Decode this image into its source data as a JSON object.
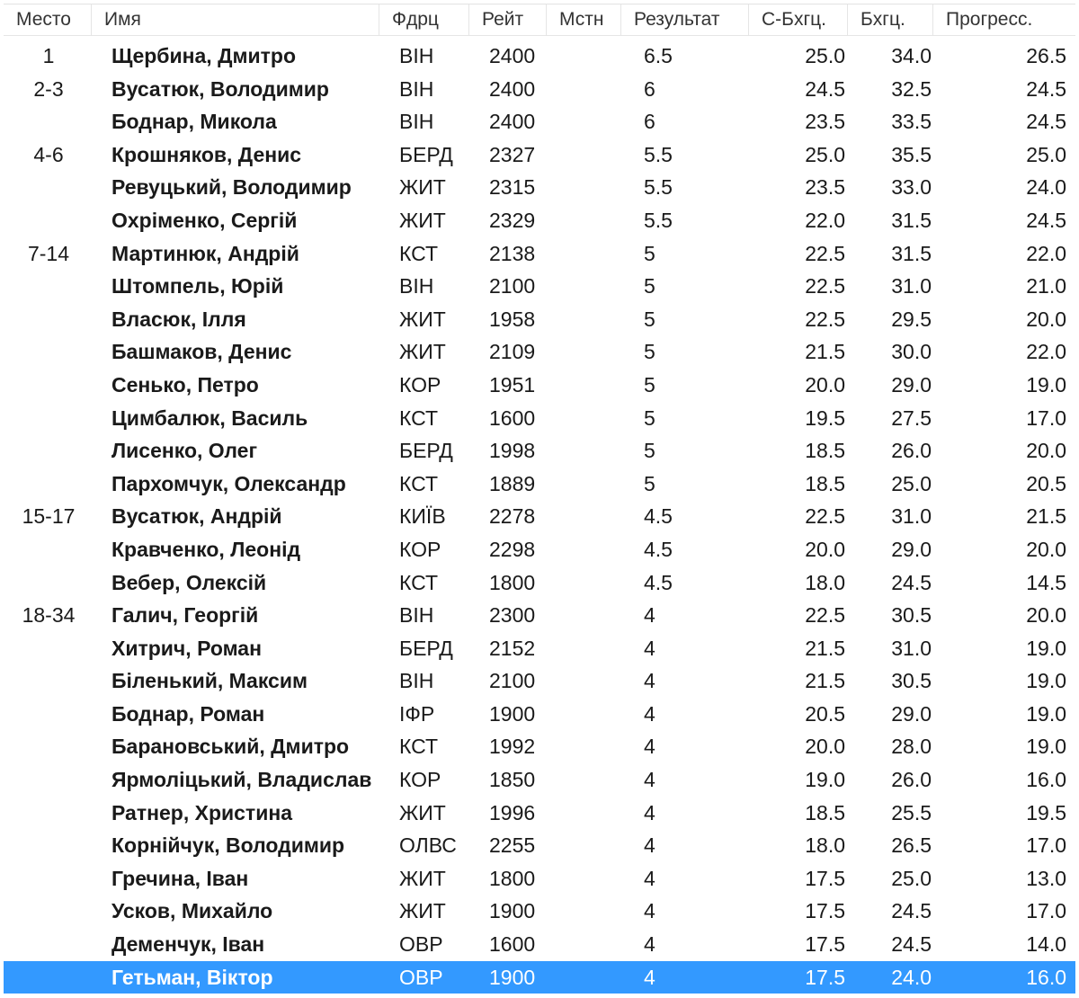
{
  "columns": {
    "place": "Место",
    "name": "Имя",
    "fed": "Фдрц",
    "rating": "Рейт",
    "local": "Мстн",
    "result": "Результат",
    "sbh": "С-Бхгц.",
    "bh": "Бхгц.",
    "prog": "Прогресс."
  },
  "selected_row_index": 28,
  "rows": [
    {
      "place": "1",
      "name": "Щербина, Дмитро",
      "fed": "ВІН",
      "rating": "2400",
      "local": "",
      "result": "6.5",
      "sbh": "25.0",
      "bh": "34.0",
      "prog": "26.5"
    },
    {
      "place": "2-3",
      "name": "Вусатюк, Володимир",
      "fed": "ВІН",
      "rating": "2400",
      "local": "",
      "result": "6",
      "sbh": "24.5",
      "bh": "32.5",
      "prog": "24.5"
    },
    {
      "place": "",
      "name": "Боднар, Микола",
      "fed": "ВІН",
      "rating": "2400",
      "local": "",
      "result": "6",
      "sbh": "23.5",
      "bh": "33.5",
      "prog": "24.5"
    },
    {
      "place": "4-6",
      "name": "Крошняков, Денис",
      "fed": "БЕРД",
      "rating": "2327",
      "local": "",
      "result": "5.5",
      "sbh": "25.0",
      "bh": "35.5",
      "prog": "25.0"
    },
    {
      "place": "",
      "name": "Ревуцький, Володимир",
      "fed": "ЖИТ",
      "rating": "2315",
      "local": "",
      "result": "5.5",
      "sbh": "23.5",
      "bh": "33.0",
      "prog": "24.0"
    },
    {
      "place": "",
      "name": "Охріменко, Сергій",
      "fed": "ЖИТ",
      "rating": "2329",
      "local": "",
      "result": "5.5",
      "sbh": "22.0",
      "bh": "31.5",
      "prog": "24.5"
    },
    {
      "place": "7-14",
      "name": "Мартинюк, Андрій",
      "fed": "КСТ",
      "rating": "2138",
      "local": "",
      "result": "5",
      "sbh": "22.5",
      "bh": "31.5",
      "prog": "22.0"
    },
    {
      "place": "",
      "name": "Штомпель, Юрій",
      "fed": "ВІН",
      "rating": "2100",
      "local": "",
      "result": "5",
      "sbh": "22.5",
      "bh": "31.0",
      "prog": "21.0"
    },
    {
      "place": "",
      "name": "Власюк, Ілля",
      "fed": "ЖИТ",
      "rating": "1958",
      "local": "",
      "result": "5",
      "sbh": "22.5",
      "bh": "29.5",
      "prog": "20.0"
    },
    {
      "place": "",
      "name": "Башмаков, Денис",
      "fed": "ЖИТ",
      "rating": "2109",
      "local": "",
      "result": "5",
      "sbh": "21.5",
      "bh": "30.0",
      "prog": "22.0"
    },
    {
      "place": "",
      "name": "Сенько, Петро",
      "fed": "КОР",
      "rating": "1951",
      "local": "",
      "result": "5",
      "sbh": "20.0",
      "bh": "29.0",
      "prog": "19.0"
    },
    {
      "place": "",
      "name": "Цимбалюк, Василь",
      "fed": "КСТ",
      "rating": "1600",
      "local": "",
      "result": "5",
      "sbh": "19.5",
      "bh": "27.5",
      "prog": "17.0"
    },
    {
      "place": "",
      "name": "Лисенко, Олег",
      "fed": "БЕРД",
      "rating": "1998",
      "local": "",
      "result": "5",
      "sbh": "18.5",
      "bh": "26.0",
      "prog": "20.0"
    },
    {
      "place": "",
      "name": "Пархомчук, Олександр",
      "fed": "КСТ",
      "rating": "1889",
      "local": "",
      "result": "5",
      "sbh": "18.5",
      "bh": "25.0",
      "prog": "20.5"
    },
    {
      "place": "15-17",
      "name": "Вусатюк, Андрій",
      "fed": "КИЇВ",
      "rating": "2278",
      "local": "",
      "result": "4.5",
      "sbh": "22.5",
      "bh": "31.0",
      "prog": "21.5"
    },
    {
      "place": "",
      "name": "Кравченко, Леонід",
      "fed": "КОР",
      "rating": "2298",
      "local": "",
      "result": "4.5",
      "sbh": "20.0",
      "bh": "29.0",
      "prog": "20.0"
    },
    {
      "place": "",
      "name": "Вебер, Олексій",
      "fed": "КСТ",
      "rating": "1800",
      "local": "",
      "result": "4.5",
      "sbh": "18.0",
      "bh": "24.5",
      "prog": "14.5"
    },
    {
      "place": "18-34",
      "name": "Галич, Георгій",
      "fed": "ВІН",
      "rating": "2300",
      "local": "",
      "result": "4",
      "sbh": "22.5",
      "bh": "30.5",
      "prog": "20.0"
    },
    {
      "place": "",
      "name": "Хитрич, Роман",
      "fed": "БЕРД",
      "rating": "2152",
      "local": "",
      "result": "4",
      "sbh": "21.5",
      "bh": "31.0",
      "prog": "19.0"
    },
    {
      "place": "",
      "name": "Біленький, Максим",
      "fed": "ВІН",
      "rating": "2100",
      "local": "",
      "result": "4",
      "sbh": "21.5",
      "bh": "30.5",
      "prog": "19.0"
    },
    {
      "place": "",
      "name": "Боднар, Роман",
      "fed": "ІФР",
      "rating": "1900",
      "local": "",
      "result": "4",
      "sbh": "20.5",
      "bh": "29.0",
      "prog": "19.0"
    },
    {
      "place": "",
      "name": "Барановський, Дмитро",
      "fed": "КСТ",
      "rating": "1992",
      "local": "",
      "result": "4",
      "sbh": "20.0",
      "bh": "28.0",
      "prog": "19.0"
    },
    {
      "place": "",
      "name": "Ярмоліцький, Владислав",
      "fed": "КОР",
      "rating": "1850",
      "local": "",
      "result": "4",
      "sbh": "19.0",
      "bh": "26.0",
      "prog": "16.0"
    },
    {
      "place": "",
      "name": "Ратнер, Христина",
      "fed": "ЖИТ",
      "rating": "1996",
      "local": "",
      "result": "4",
      "sbh": "18.5",
      "bh": "25.5",
      "prog": "19.5"
    },
    {
      "place": "",
      "name": "Корнійчук, Володимир",
      "fed": "ОЛВС",
      "rating": "2255",
      "local": "",
      "result": "4",
      "sbh": "18.0",
      "bh": "26.5",
      "prog": "17.0"
    },
    {
      "place": "",
      "name": "Гречина, Іван",
      "fed": "ЖИТ",
      "rating": "1800",
      "local": "",
      "result": "4",
      "sbh": "17.5",
      "bh": "25.0",
      "prog": "13.0"
    },
    {
      "place": "",
      "name": "Усков, Михайло",
      "fed": "ЖИТ",
      "rating": "1900",
      "local": "",
      "result": "4",
      "sbh": "17.5",
      "bh": "24.5",
      "prog": "17.0"
    },
    {
      "place": "",
      "name": "Деменчук, Іван",
      "fed": "ОВР",
      "rating": "1600",
      "local": "",
      "result": "4",
      "sbh": "17.5",
      "bh": "24.5",
      "prog": "14.0"
    },
    {
      "place": "",
      "name": "Гетьман, Віктор",
      "fed": "ОВР",
      "rating": "1900",
      "local": "",
      "result": "4",
      "sbh": "17.5",
      "bh": "24.0",
      "prog": "16.0"
    }
  ],
  "colors": {
    "selection": "#3399ff",
    "selection_text": "#ffffff",
    "text": "#1a1a1a",
    "header_text": "#333333"
  }
}
